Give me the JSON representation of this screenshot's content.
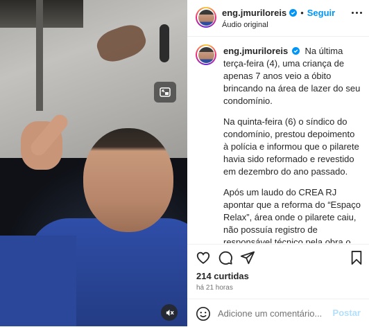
{
  "post": {
    "username": "eng.jmuriloreis",
    "follow_label": "Seguir",
    "separator": "•",
    "audio_label": "Áudio original",
    "caption_paragraphs": [
      "Na última terça-feira (4), uma criança de apenas 7 anos veio a óbito brincando na área de lazer do seu condomínio.",
      "Na quinta-feira (6) o síndico do condomínio, prestou depoimento à polícia e informou que o pilarete havia sido reformado e revestido em dezembro do ano passado.",
      "Após um laudo do CREA RJ apontar que a reforma do “Espaço Relax”, área onde o pilarete caiu, não possuía registro de responsável técnico pela obra o conselho anunciou que abrirá um auto de infração contra o condomínio localizado no Recreio dos Bandeirantes, zona oeste do Rio de Janeiro."
    ],
    "likes": "214 curtidas",
    "time_ago": "há 21 horas",
    "comment_placeholder": "Adicione um comentário...",
    "post_label": "Postar"
  },
  "icons": {
    "verified": "verified-badge-icon",
    "more": "more-options-icon",
    "like": "heart-icon",
    "comment": "comment-icon",
    "share": "share-icon",
    "save": "bookmark-icon",
    "emoji": "emoji-icon",
    "pip": "picture-in-picture-icon",
    "mute": "muted-speaker-icon"
  },
  "colors": {
    "accent": "#0095f6",
    "post_disabled": "#b2dffc",
    "text": "#262626",
    "muted_text": "#737373"
  }
}
